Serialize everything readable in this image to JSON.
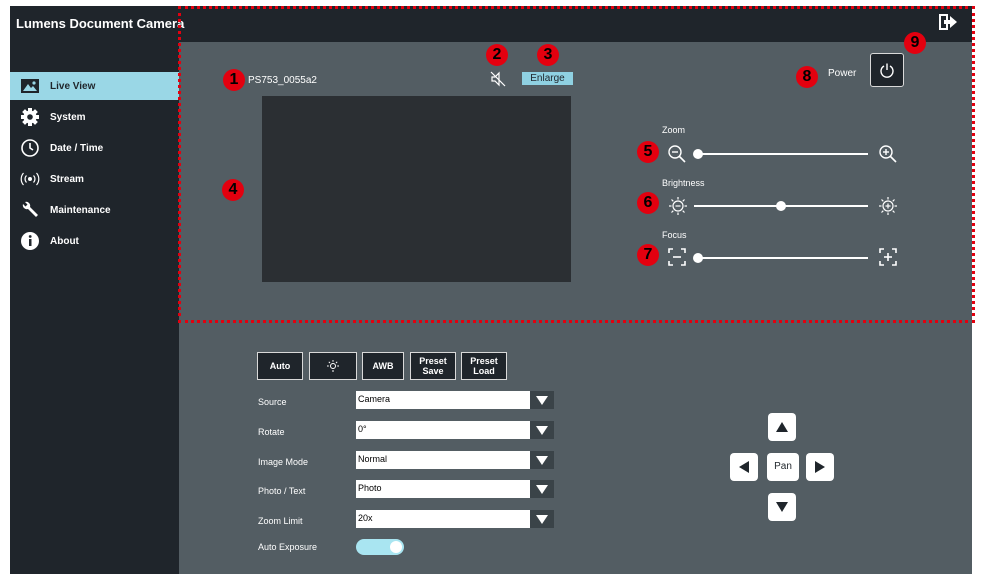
{
  "app": {
    "title": "Lumens Document Camera"
  },
  "sidebar": {
    "items": [
      {
        "label": "Live View",
        "icon": "image-icon",
        "active": true
      },
      {
        "label": "System",
        "icon": "gear-icon",
        "active": false
      },
      {
        "label": "Date / Time",
        "icon": "clock-icon",
        "active": false
      },
      {
        "label": "Stream",
        "icon": "broadcast-icon",
        "active": false
      },
      {
        "label": "Maintenance",
        "icon": "wrench-icon",
        "active": false
      },
      {
        "label": "About",
        "icon": "info-icon",
        "active": false
      }
    ]
  },
  "live": {
    "camera_name": "PS753_0055a2",
    "enlarge_label": "Enlarge",
    "power_label": "Power",
    "zoom_label": "Zoom",
    "brightness_label": "Brightness",
    "focus_label": "Focus",
    "zoom_value": 0,
    "brightness_value": 0.5,
    "focus_value": 0
  },
  "callouts": [
    "1",
    "2",
    "3",
    "4",
    "5",
    "6",
    "7",
    "8",
    "9"
  ],
  "toolbar": {
    "auto_label": "Auto",
    "awb_label": "AWB",
    "preset_save_label": "Preset\nSave",
    "preset_load_label": "Preset\nLoad"
  },
  "settings": {
    "source_label": "Source",
    "source_value": "Camera",
    "rotate_label": "Rotate",
    "rotate_value": "0°",
    "image_mode_label": "Image Mode",
    "image_mode_value": "Normal",
    "photo_text_label": "Photo / Text",
    "photo_text_value": "Photo",
    "zoom_limit_label": "Zoom Limit",
    "zoom_limit_value": "20x",
    "auto_exposure_label": "Auto Exposure",
    "auto_exposure_on": true
  },
  "pan": {
    "label": "Pan"
  },
  "colors": {
    "accent": "#9ad7e6",
    "callout": "#e3000f",
    "sidebar": "#1f252b",
    "panel": "#535d63"
  }
}
